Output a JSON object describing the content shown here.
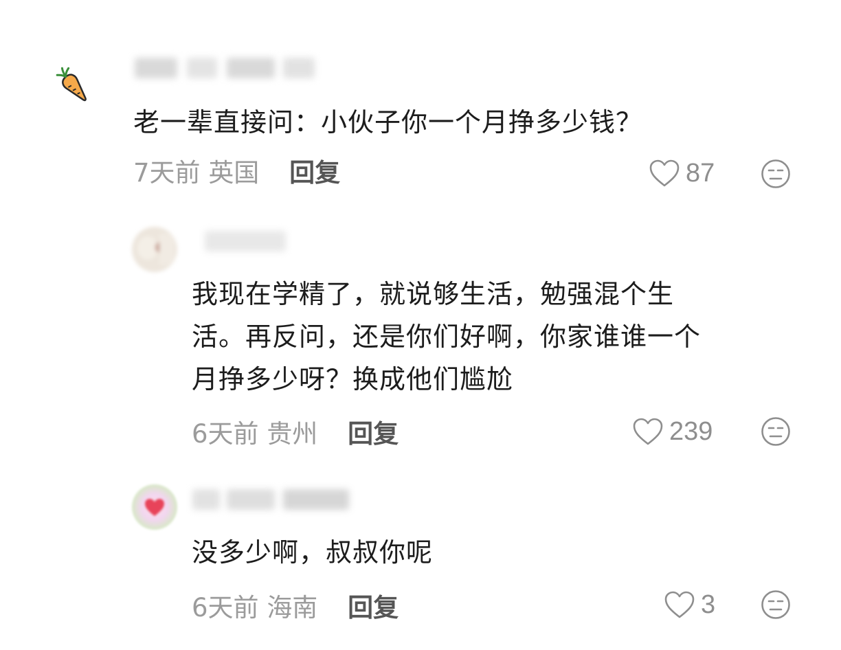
{
  "comments": [
    {
      "text": "老一辈直接问：小伙子你一个月挣多少钱？",
      "time": "7天前",
      "location": "英国",
      "reply_label": "回复",
      "likes": "87"
    },
    {
      "text_lines": [
        "我现在学精了，就说够生活，勉强混个生",
        "活。再反问，还是你们好啊，你家谁谁一个",
        "月挣多少呀？换成他们尴尬"
      ],
      "time": "6天前",
      "location": "贵州",
      "reply_label": "回复",
      "likes": "239"
    },
    {
      "text": "没多少啊，叔叔你呢",
      "time": "6天前",
      "location": "海南",
      "reply_label": "回复",
      "likes": "3"
    }
  ],
  "icons": {
    "like": "heart-outline-icon",
    "dislike": "meh-face-icon",
    "avatar_1": "carrot-icon"
  },
  "colors": {
    "meta_text": "#9b9b9b",
    "reply_text": "#555555",
    "body_text": "#1c1c1c"
  }
}
